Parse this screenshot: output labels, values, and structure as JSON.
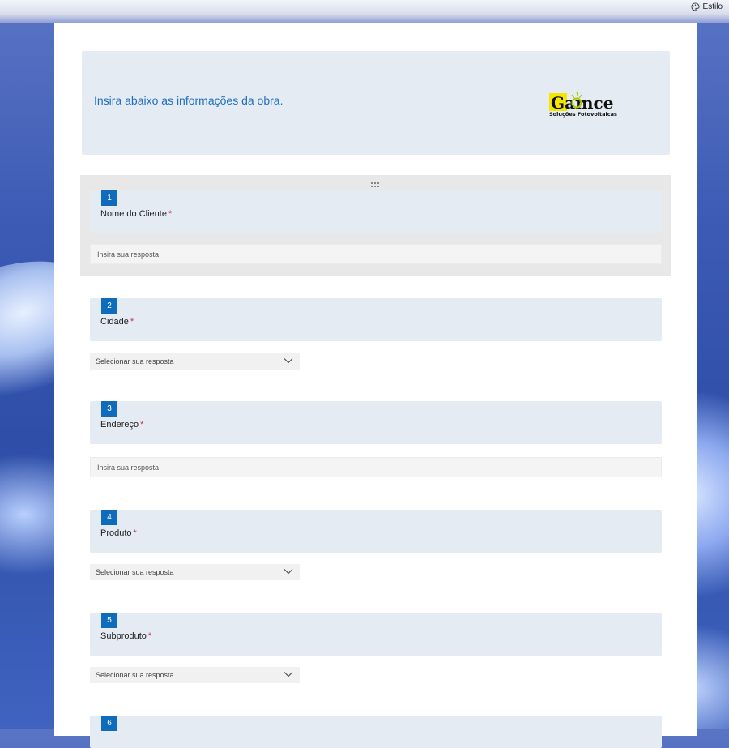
{
  "topbar": {
    "style_label": "Estilo"
  },
  "form": {
    "header_text": "Insira abaixo as informações da obra.",
    "logo": {
      "name": "Garonce",
      "tagline": "Soluções Fotovoltaicas"
    },
    "required_mark": "*",
    "questions": [
      {
        "number": "1",
        "label": "Nome do Cliente",
        "type": "text",
        "placeholder": "Insira sua resposta"
      },
      {
        "number": "2",
        "label": "Cidade",
        "type": "select",
        "placeholder": "Selecionar sua resposta"
      },
      {
        "number": "3",
        "label": "Endereço",
        "type": "text",
        "placeholder": "Insira sua resposta"
      },
      {
        "number": "4",
        "label": "Produto",
        "type": "select",
        "placeholder": "Selecionar sua resposta"
      },
      {
        "number": "5",
        "label": "Subproduto",
        "type": "select",
        "placeholder": "Selecionar sua resposta"
      },
      {
        "number": "6",
        "label": "",
        "type": "unknown",
        "placeholder": ""
      }
    ]
  },
  "colors": {
    "accent": "#0f6cbd",
    "header_text": "#1f6fbf",
    "required": "#c4314b",
    "card": "#e5ebf3"
  }
}
